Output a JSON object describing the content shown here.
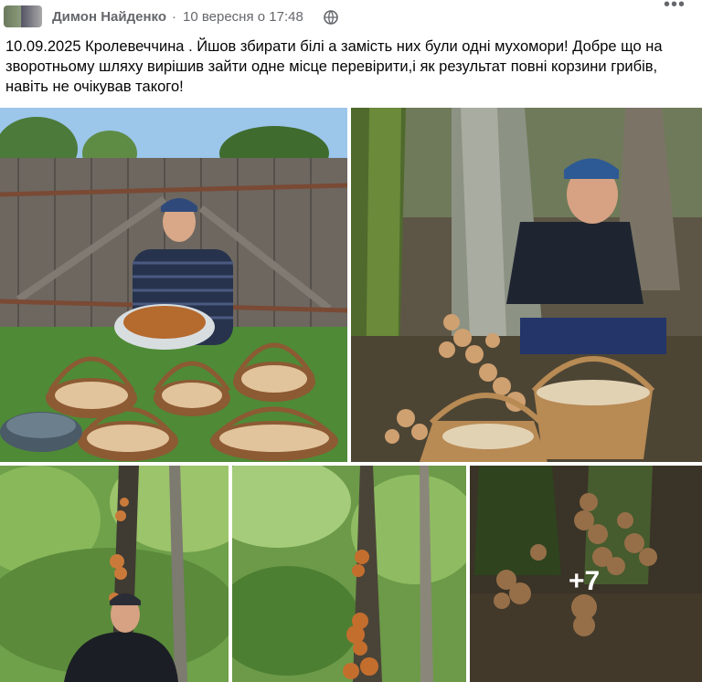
{
  "post": {
    "author": "Димон Найденко",
    "separator": "·",
    "timestamp": "10 вересня о 17:48",
    "text": "10.09.2025 Кролевеччина . Йшов збирати білі а замість них були одні мухомори! Добре що на зворотньому шляху вирішив зайти одне місце перевірити,і як результат повні корзини грибів, навіть не очікував такого!",
    "audience_icon": "globe-icon",
    "menu_icon": "more-options-icon"
  },
  "gallery": {
    "photos": [
      {
        "icon": "photo-man-with-mushroom-baskets"
      },
      {
        "icon": "photo-man-with-basket-in-forest"
      },
      {
        "icon": "photo-man-under-mushroom-tree"
      },
      {
        "icon": "photo-mushrooms-on-tree-trunk"
      },
      {
        "icon": "photo-mushroom-clusters"
      }
    ],
    "more_count": "+7"
  }
}
